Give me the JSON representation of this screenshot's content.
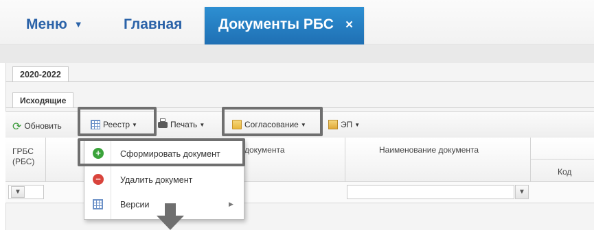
{
  "header": {
    "menu_label": "Меню",
    "home_label": "Главная",
    "active_tab_label": "Документы РБС",
    "close_glyph": "×"
  },
  "tabs": {
    "period": "2020-2022",
    "subtab": "Исходящие"
  },
  "toolbar": {
    "refresh": "Обновить",
    "registry": "Реестр",
    "print": "Печать",
    "approval": "Согласование",
    "ep": "ЭП"
  },
  "grid": {
    "col_grbs": "ГРБС\n(РБС)",
    "col_doc_partial": "документа",
    "col_doc_name": "Наименование документа",
    "col_code": "Код"
  },
  "menu": {
    "items": [
      {
        "label": "Сформировать документ",
        "icon": "add-icon",
        "color": "#3aa33a"
      },
      {
        "label": "Удалить документ",
        "icon": "remove-icon",
        "color": "#d9443c"
      },
      {
        "label": "Версии",
        "icon": "grid-icon",
        "color": "#6c91c7"
      }
    ]
  },
  "colors": {
    "accent_blue": "#2a62a8",
    "active_tab": "#1f6fb3",
    "highlight_box": "#6f6f6f"
  }
}
